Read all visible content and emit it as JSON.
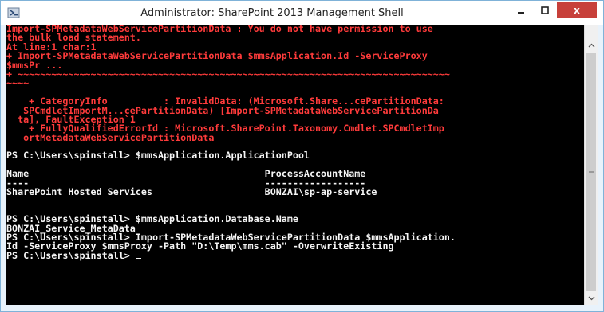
{
  "window": {
    "title": "Administrator: SharePoint 2013 Management Shell",
    "icons": {
      "app": "powershell-icon",
      "minimize": "minimize-icon",
      "maximize": "maximize-icon",
      "close": "close-icon"
    },
    "close_label": "x"
  },
  "console": {
    "colors": {
      "background": "#000000",
      "error": "#ff3b3b",
      "output": "#f5f5f5"
    },
    "lines": [
      {
        "text": "Import-SPMetadataWebServicePartitionData : You do not have permission to use",
        "type": "err"
      },
      {
        "text": "the bulk load statement.",
        "type": "err"
      },
      {
        "text": "At line:1 char:1",
        "type": "err"
      },
      {
        "text": "+ Import-SPMetadataWebServicePartitionData $mmsApplication.Id -ServiceProxy",
        "type": "err"
      },
      {
        "text": "$mmsPr ...",
        "type": "err"
      },
      {
        "text": "+ ~~~~~~~~~~~~~~~~~~~~~~~~~~~~~~~~~~~~~~~~~~~~~~~~~~~~~~~~~~~~~~~~~~~~~~~~~~~~~",
        "type": "err"
      },
      {
        "text": "~~~~",
        "type": "err"
      },
      {
        "text": "",
        "type": "err"
      },
      {
        "text": "    + CategoryInfo          : InvalidData: (Microsoft.Share...cePartitionData:",
        "type": "err"
      },
      {
        "text": "   SPCmdletImportM...cePartitionData) [Import-SPMetadataWebServicePartitionDa",
        "type": "err"
      },
      {
        "text": "  ta], FaultException`1",
        "type": "err"
      },
      {
        "text": "    + FullyQualifiedErrorId : Microsoft.SharePoint.Taxonomy.Cmdlet.SPCmdletImp",
        "type": "err"
      },
      {
        "text": "   ortMetadataWebServicePartitionData",
        "type": "err"
      },
      {
        "text": "",
        "type": "out"
      },
      {
        "text": "PS C:\\Users\\spinstall> $mmsApplication.ApplicationPool",
        "type": "out"
      },
      {
        "text": "",
        "type": "out"
      },
      {
        "text": "Name                                          ProcessAccountName",
        "type": "out"
      },
      {
        "text": "----                                          ------------------",
        "type": "out"
      },
      {
        "text": "SharePoint Hosted Services                    BONZAI\\sp-ap-service",
        "type": "out"
      },
      {
        "text": "",
        "type": "out"
      },
      {
        "text": "",
        "type": "out"
      },
      {
        "text": "PS C:\\Users\\spinstall> $mmsApplication.Database.Name",
        "type": "out"
      },
      {
        "text": "BONZAI_Service_MetaData",
        "type": "out"
      },
      {
        "text": "PS C:\\Users\\spinstall> Import-SPMetadataWebServicePartitionData $mmsApplication.",
        "type": "out"
      },
      {
        "text": "Id -ServiceProxy $mmsProxy -Path \"D:\\Temp\\mms.cab\" -OverwriteExisting",
        "type": "out"
      },
      {
        "text": "PS C:\\Users\\spinstall> ",
        "type": "out",
        "cursor": true
      }
    ]
  },
  "scrollbar": {
    "icons": {
      "up": "chevron-up-icon",
      "down": "chevron-down-icon",
      "grip": "grip-icon"
    }
  }
}
